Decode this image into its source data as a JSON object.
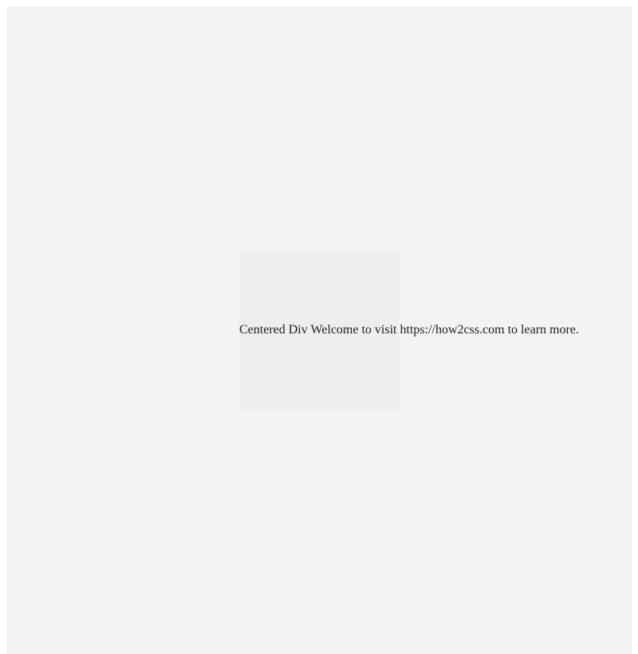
{
  "card": {
    "line1": "Centered Div Welcome to visit ",
    "line2": "https://how2css.com to learn ",
    "line3": "more."
  }
}
